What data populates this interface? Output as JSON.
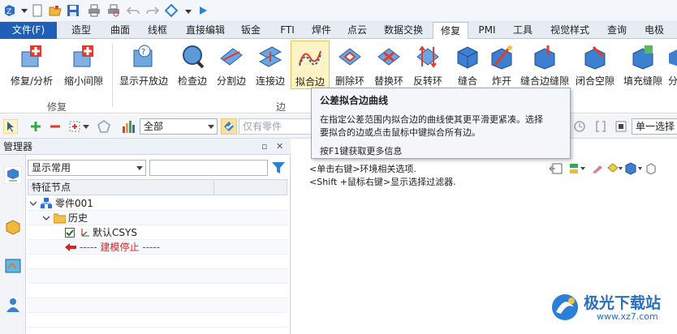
{
  "menubar": {
    "items": [
      "文件(F)",
      "造型",
      "曲面",
      "线框",
      "直接编辑",
      "钣金",
      "FTI",
      "焊件",
      "点云",
      "数据交换",
      "修复",
      "PMI",
      "工具",
      "视觉样式",
      "查询",
      "电极"
    ],
    "active": "修复"
  },
  "ribbon": {
    "buttons": [
      "修复/分析",
      "缩小间隙",
      "显示开放边",
      "检查边",
      "分割边",
      "连接边",
      "拟合边",
      "删除环",
      "替换环",
      "反转环",
      "缝合",
      "炸开",
      "缝合边缝隙",
      "闭合空隙",
      "填充缝隙",
      "分"
    ],
    "groups": [
      "修复",
      "边"
    ]
  },
  "toolbar": {
    "filter_value": "全部",
    "only_parts": "仅有零件",
    "select_mode": "单一选择"
  },
  "manager": {
    "title": "管理器",
    "pin": "▫",
    "close": "✕",
    "view_select": "显示常用",
    "column_header": "特征节点",
    "tree": {
      "part": "零件001",
      "history": "历史",
      "csys": "默认CSYS",
      "stop": "----- 建模停止 -----"
    }
  },
  "canvas": {
    "hint1": "<单击右键>环境相关选项.",
    "hint2": "<Shift +鼠标右键>显示选择过滤器."
  },
  "tooltip": {
    "title": "公差拟合边曲线",
    "line1": "在指定公差范围内拟合边的曲线使其更平滑更紧凑。选择",
    "line2": "要拟合的边或点击鼠标中键拟合所有边。",
    "help": "按F1键获取更多信息"
  },
  "watermark": {
    "name": "极光下载站",
    "url": "www.xz7.com"
  },
  "colors": {
    "file_menu": "#1f5fb5",
    "highlight": "#fdf3c4",
    "stop_red": "#e02020"
  }
}
